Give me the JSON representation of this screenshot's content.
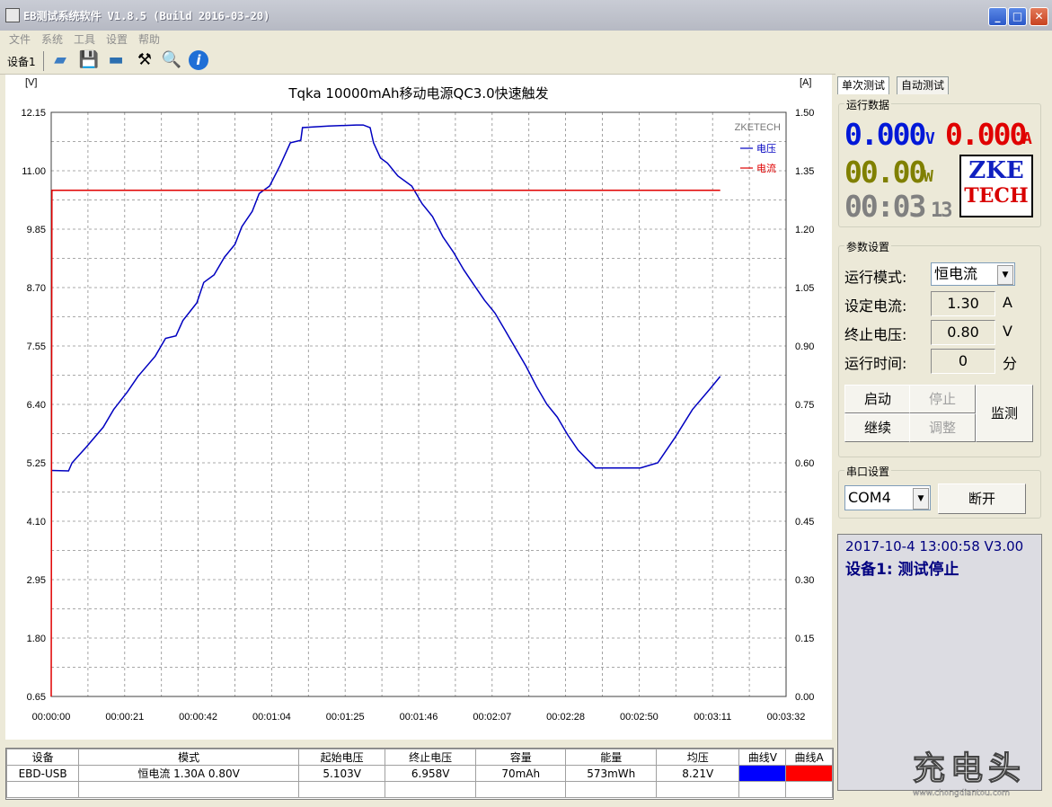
{
  "window": {
    "title": "EB测试系统软件 V1.8.5 (Build 2016-03-20)"
  },
  "menu": [
    "文件",
    "系统",
    "工具",
    "设置",
    "帮助"
  ],
  "toolbar": {
    "device_tab": "设备1"
  },
  "chart_data": {
    "type": "line",
    "title": "Tqka 10000mAh移动电源QC3.0快速触发",
    "left_unit": "[V]",
    "right_unit": "[A]",
    "watermark": "ZKETECH",
    "yleft_ticks": [
      "12.15",
      "11.00",
      "9.85",
      "8.70",
      "7.55",
      "6.40",
      "5.25",
      "4.10",
      "2.95",
      "1.80",
      "0.65"
    ],
    "yright_ticks": [
      "1.50",
      "1.35",
      "1.20",
      "1.05",
      "0.90",
      "0.75",
      "0.60",
      "0.45",
      "0.30",
      "0.15",
      "0.00"
    ],
    "x_ticks": [
      "00:00:00",
      "00:00:21",
      "00:00:42",
      "00:01:04",
      "00:01:25",
      "00:01:46",
      "00:02:07",
      "00:02:28",
      "00:02:50",
      "00:03:11",
      "00:03:32"
    ],
    "yleft_range": [
      0.65,
      12.15
    ],
    "yright_range": [
      0.0,
      1.5
    ],
    "x_range_s": [
      0,
      212
    ],
    "series": [
      {
        "name": "电压",
        "color": "#0000c0",
        "axis": "left",
        "points": [
          [
            0,
            5.1
          ],
          [
            5,
            5.09
          ],
          [
            6,
            5.25
          ],
          [
            10,
            5.55
          ],
          [
            15,
            5.95
          ],
          [
            18,
            6.3
          ],
          [
            22,
            6.65
          ],
          [
            25,
            6.95
          ],
          [
            30,
            7.35
          ],
          [
            33,
            7.7
          ],
          [
            36,
            7.75
          ],
          [
            38,
            8.05
          ],
          [
            42,
            8.4
          ],
          [
            44,
            8.8
          ],
          [
            47,
            8.95
          ],
          [
            50,
            9.3
          ],
          [
            53,
            9.55
          ],
          [
            55,
            9.9
          ],
          [
            58,
            10.2
          ],
          [
            60,
            10.55
          ],
          [
            63,
            10.7
          ],
          [
            66,
            11.1
          ],
          [
            69,
            11.55
          ],
          [
            72,
            11.6
          ],
          [
            72.5,
            11.85
          ],
          [
            80,
            11.88
          ],
          [
            88,
            11.9
          ],
          [
            90,
            11.9
          ],
          [
            92,
            11.85
          ],
          [
            93,
            11.55
          ],
          [
            95,
            11.25
          ],
          [
            97,
            11.15
          ],
          [
            100,
            10.9
          ],
          [
            104,
            10.7
          ],
          [
            107,
            10.35
          ],
          [
            110,
            10.1
          ],
          [
            113,
            9.7
          ],
          [
            116,
            9.4
          ],
          [
            119,
            9.05
          ],
          [
            122,
            8.75
          ],
          [
            125,
            8.45
          ],
          [
            128,
            8.2
          ],
          [
            131,
            7.85
          ],
          [
            134,
            7.5
          ],
          [
            137,
            7.15
          ],
          [
            140,
            6.75
          ],
          [
            143,
            6.4
          ],
          [
            146,
            6.15
          ],
          [
            149,
            5.8
          ],
          [
            152,
            5.5
          ],
          [
            157,
            5.15
          ],
          [
            170,
            5.15
          ],
          [
            175,
            5.25
          ],
          [
            180,
            5.75
          ],
          [
            185,
            6.3
          ],
          [
            190,
            6.7
          ],
          [
            193,
            6.95
          ]
        ]
      },
      {
        "name": "电流",
        "color": "#e00000",
        "axis": "right",
        "points": [
          [
            0,
            0
          ],
          [
            0.2,
            1.3
          ],
          [
            193,
            1.3
          ]
        ]
      }
    ]
  },
  "table": {
    "headers": [
      "设备",
      "模式",
      "起始电压",
      "终止电压",
      "容量",
      "能量",
      "均压",
      "曲线V",
      "曲线A"
    ],
    "rows": [
      [
        "EBD-USB",
        "恒电流 1.30A 0.80V",
        "5.103V",
        "6.958V",
        "70mAh",
        "573mWh",
        "8.21V",
        "",
        ""
      ]
    ],
    "curve_colors": [
      "#0000ff",
      "#ff0000"
    ]
  },
  "right": {
    "tabs": [
      "单次测试",
      "自动测试"
    ],
    "run_data_label": "运行数据",
    "voltage": "0.000",
    "voltage_unit": "V",
    "current": "0.000",
    "current_unit": "A",
    "power": "00.00",
    "power_unit": "W",
    "time": "00:03",
    "time_sec": "13",
    "logo_line1": "ZKE",
    "logo_line2": "TECH",
    "param_label": "参数设置",
    "mode_label": "运行模式:",
    "mode_value": "恒电流",
    "set_current_label": "设定电流:",
    "set_current_value": "1.30",
    "set_current_unit": "A",
    "end_voltage_label": "终止电压:",
    "end_voltage_value": "0.80",
    "end_voltage_unit": "V",
    "run_time_label": "运行时间:",
    "run_time_value": "0",
    "run_time_unit": "分",
    "btn_start": "启动",
    "btn_stop": "停止",
    "btn_continue": "继续",
    "btn_adjust": "调整",
    "btn_monitor": "监测",
    "serial_label": "串口设置",
    "com_value": "COM4",
    "btn_disconnect": "断开",
    "log_line1": "2017-10-4 13:00:58  V3.00",
    "log_line2": "设备1: 测试停止",
    "watermark_text": "充电头",
    "watermark_url": "www.chongdiantou.com"
  }
}
